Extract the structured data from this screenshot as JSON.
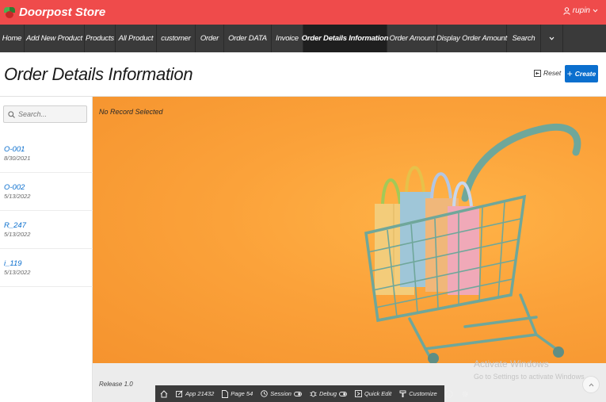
{
  "header": {
    "brand": "Doorpost Store",
    "user": "rupin"
  },
  "nav": {
    "items": [
      {
        "label": "Home",
        "w": 31
      },
      {
        "label": "Add New Product",
        "w": 76
      },
      {
        "label": "Products",
        "w": 39
      },
      {
        "label": "All Product",
        "w": 52
      },
      {
        "label": "customer",
        "w": 49
      },
      {
        "label": "Order",
        "w": 36
      },
      {
        "label": "Order DATA",
        "w": 60
      },
      {
        "label": "Invoice",
        "w": 40
      },
      {
        "label": "Order Details Information",
        "w": 106,
        "active": true
      },
      {
        "label": "Order Amount",
        "w": 63
      },
      {
        "label": "Display Order Amount",
        "w": 88
      },
      {
        "label": "Search",
        "w": 43
      }
    ]
  },
  "title_region": {
    "title": "Order Details Information",
    "reset_label": "Reset",
    "create_label": "Create"
  },
  "search": {
    "placeholder": "Search..."
  },
  "list": [
    {
      "id": "O-001",
      "date": "8/30/2021"
    },
    {
      "id": "O-002",
      "date": "5/13/2022"
    },
    {
      "id": "R_247",
      "date": "5/13/2022"
    },
    {
      "id": "i_119",
      "date": "5/13/2022"
    }
  ],
  "content": {
    "no_record": "No Record Selected"
  },
  "footer": {
    "release": "Release 1.0",
    "watermark_title": "Activate Windows",
    "watermark_text": "Go to Settings to activate Windows."
  },
  "devbar": {
    "app": "App 21432",
    "page": "Page 54",
    "session": "Session",
    "debug": "Debug",
    "quick_edit": "Quick Edit",
    "customize": "Customize"
  }
}
